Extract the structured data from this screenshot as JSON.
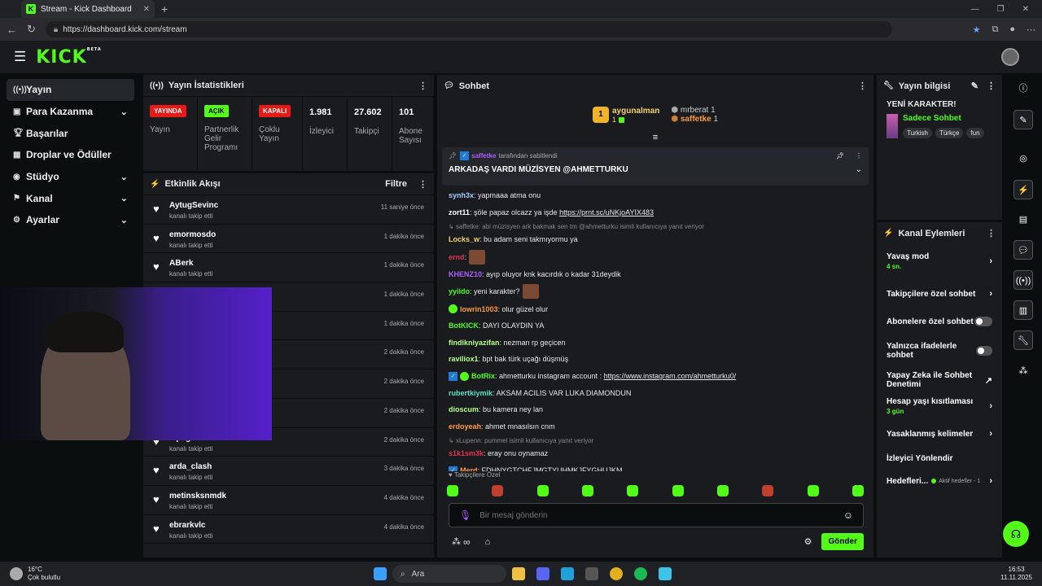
{
  "browser": {
    "tab_title": "Stream - Kick Dashboard",
    "url": "https://dashboard.kick.com/stream"
  },
  "brand": {
    "logo": "KICK",
    "beta": "BETA",
    "accent": "#53fc18"
  },
  "sidebar": {
    "items": [
      {
        "label": "Yayın",
        "icon": "broadcast-icon",
        "chev": false
      },
      {
        "label": "Para Kazanma",
        "icon": "money-icon",
        "chev": true
      },
      {
        "label": "Başarılar",
        "icon": "trophy-icon",
        "chev": false
      },
      {
        "label": "Droplar ve Ödüller",
        "icon": "gift-icon",
        "chev": false
      },
      {
        "label": "Stüdyo",
        "icon": "studio-icon",
        "chev": true
      },
      {
        "label": "Kanal",
        "icon": "channel-icon",
        "chev": true
      },
      {
        "label": "Ayarlar",
        "icon": "gear-icon",
        "chev": true
      }
    ]
  },
  "stats": {
    "title": "Yayın İstatistikleri",
    "items": [
      {
        "badge": "YAYINDA",
        "label": "Yayın"
      },
      {
        "badge": "AÇIK",
        "label": "Partnerlik Gelir Programı"
      },
      {
        "badge": "KAPALI",
        "label": "Çoklu Yayın"
      },
      {
        "num": "1.981",
        "label": "İzleyici"
      },
      {
        "num": "27.602",
        "label": "Takipçi"
      },
      {
        "num": "101",
        "label": "Abone Sayısı"
      }
    ]
  },
  "activity": {
    "title": "Etkinlik Akışı",
    "filter": "Filtre",
    "rows": [
      {
        "name": "AytugSevinc",
        "sub": "kanalı takip etti",
        "time": "11 saniye önce"
      },
      {
        "name": "emormosdo",
        "sub": "kanalı takip etti",
        "time": "1 dakika önce"
      },
      {
        "name": "ABerk",
        "sub": "kanalı takip etti",
        "time": "1 dakika önce"
      },
      {
        "name": "",
        "sub": "",
        "time": "1 dakika önce"
      },
      {
        "name": "",
        "sub": "",
        "time": "1 dakika önce"
      },
      {
        "name": "",
        "sub": "",
        "time": "2 dakika önce"
      },
      {
        "name": "",
        "sub": "",
        "time": "2 dakika önce"
      },
      {
        "name": "",
        "sub": "",
        "time": "2 dakika önce"
      },
      {
        "name": "alpagox",
        "sub": "kanalı takip etti",
        "time": "2 dakika önce"
      },
      {
        "name": "arda_clash",
        "sub": "kanalı takip etti",
        "time": "3 dakika önce"
      },
      {
        "name": "metinsksnmdk",
        "sub": "kanalı takip etti",
        "time": "4 dakika önce"
      },
      {
        "name": "ebrarkvlc",
        "sub": "kanalı takip etti",
        "time": "4 dakika önce"
      }
    ]
  },
  "chat": {
    "title": "Sohbet",
    "top": {
      "first_name": "aygunalman",
      "first_count": "1",
      "second_name": "mrberat",
      "second_count": "1",
      "third_name": "saffetke",
      "third_count": "1"
    },
    "pinned": {
      "by": "saffetke",
      "by_suffix": "tarafından sabitlendi",
      "text": "ARKADAŞ VARDI MÜZİSYEN @AHMETTURKU"
    },
    "messages": [
      {
        "user": "synh3x",
        "color": "#a8c9ff",
        "text": ": yapmaaa atma onu"
      },
      {
        "user": "zort11",
        "color": "#ffffff",
        "text": ": şöle papaz olcazz ya işde ",
        "link": "https://prnt.sc/uNKjoAYIX483"
      },
      {
        "reply": "saffetke: abi müzisyen ark bakmak sen tm @ahmetturku isimli kullanıcıya yanıt veriyor"
      },
      {
        "user": "Locks_w",
        "color": "#f5d36c",
        "text": ": bu adam seni takmıyormu ya"
      },
      {
        "user": "ernd",
        "color": "#e0334c",
        "text": ":",
        "emoji": true
      },
      {
        "user": "KHENZ10",
        "color": "#b05cff",
        "text": ": ayıp oluyor knk kacırdık o kadar 31deydik"
      },
      {
        "user": "yyiido",
        "color": "#53fc18",
        "text": ": yeni karakter?",
        "emoji": true
      },
      {
        "user": "lowrin1003",
        "color": "#ff9a3c",
        "text": ": olur güzel olur"
      },
      {
        "user": "BotKICK",
        "color": "#53fc18",
        "text": ": DAYI OLAYDIN YA"
      },
      {
        "user": "findikniyazifan",
        "color": "#b6ff8a",
        "text": ": nezman rp geçicen"
      },
      {
        "user": "raviliox1",
        "color": "#b6ff8a",
        "text": ": bpt bak türk uçağı düşmüş"
      },
      {
        "user": "BotRix",
        "color": "#53fc18",
        "text": ": ahmetturku instagram account : ",
        "link": "https://www.instagram.com/ahmetturku0/"
      },
      {
        "user": "rubertkiymik",
        "color": "#5ce0c8",
        "text": ": AKSAM ACILIS VAR LUKA DIAMONDUN"
      },
      {
        "user": "dioscum",
        "color": "#b6ff8a",
        "text": ": bu kamera ney lan"
      },
      {
        "user": "erdoyeah",
        "color": "#ff9a3c",
        "text": ": ahmet mnasılsın cnm"
      },
      {
        "reply": "xLupenn: pummel isimli kullanıcıya yanıt veriyor"
      },
      {
        "user": "s1k1sm3k",
        "color": "#e0334c",
        "text": ": eray onu oynamaz"
      },
      {
        "user": "Merd",
        "color": "#ff9a3c",
        "text": ": FDHNYGTCHFJMGTYUHMKJFYGHUJKM"
      }
    ],
    "followers_only": "Takipçilere Özel",
    "placeholder": "Bir mesaj gönderin",
    "send": "Gönder",
    "infinity": "∞"
  },
  "stream_info": {
    "title": "Yayın bilgisi",
    "stream_title": "YENİ KARAKTER!",
    "category": "Sadece Sohbet",
    "tags": [
      "Turkish",
      "Türkçe",
      "fun"
    ]
  },
  "channel_actions": {
    "title": "Kanal Eylemleri",
    "rows": [
      {
        "label": "Yavaş mod",
        "sub": "4 sn.",
        "ctrl": "chev"
      },
      {
        "label": "Takipçilere özel sohbet",
        "sub": "",
        "ctrl": "chev"
      },
      {
        "label": "Abonelere özel sohbet",
        "sub": "",
        "ctrl": "toggle"
      },
      {
        "label": "Yalnızca ifadelerle sohbet",
        "sub": "",
        "ctrl": "toggle"
      },
      {
        "label": "Yapay Zeka ile Sohbet Denetimi",
        "sub": "",
        "ctrl": "ext"
      },
      {
        "label": "Hesap yaşı kısıtlaması",
        "sub": "3 gün",
        "ctrl": "chev"
      },
      {
        "label": "Yasaklanmış kelimeler",
        "sub": "",
        "ctrl": "chev"
      },
      {
        "label": "İzleyici Yönlendir",
        "sub": "",
        "ctrl": "none"
      },
      {
        "label": "Hedefleri...",
        "sub": "",
        "ctrl": "goal",
        "goal": "Aktif hedefler - 1"
      }
    ]
  },
  "taskbar": {
    "weather_temp": "16°C",
    "weather_text": "Çok bulutlu",
    "search": "Ara",
    "time": "16:53",
    "date": "11.11.2025"
  }
}
